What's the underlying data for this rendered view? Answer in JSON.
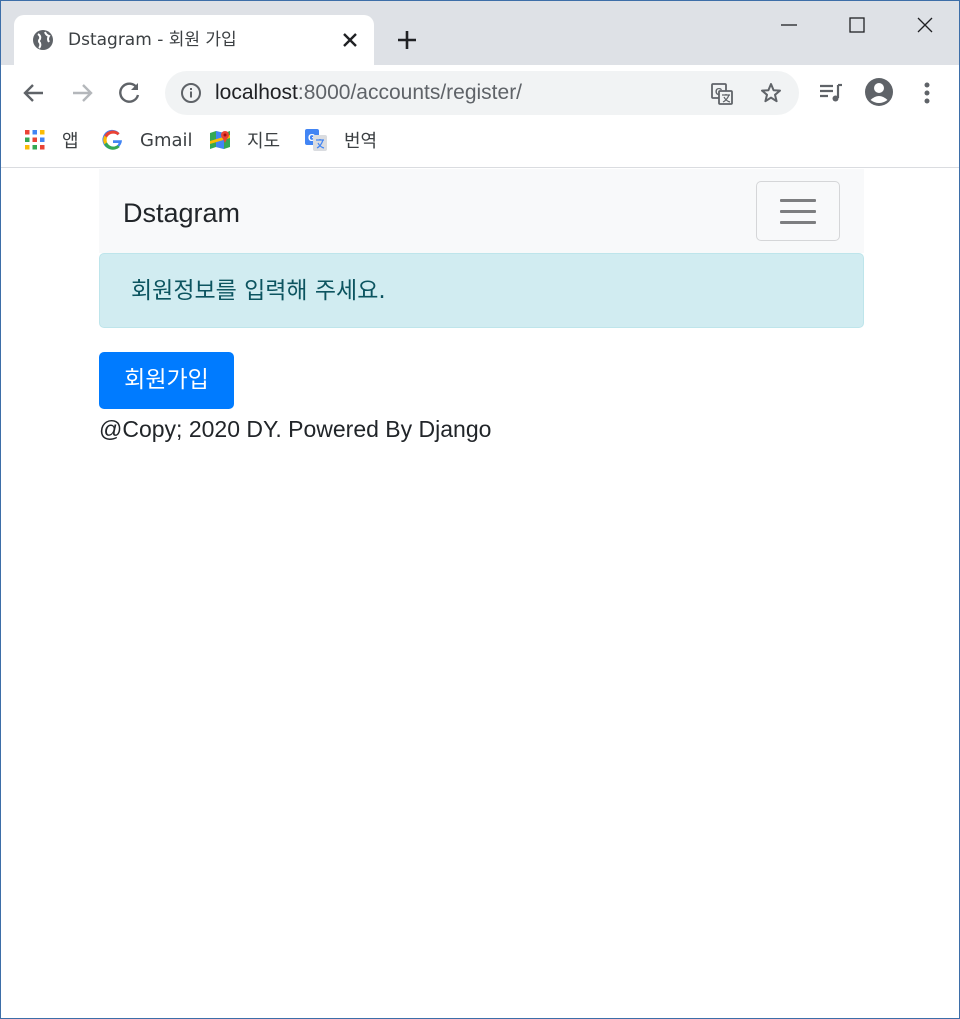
{
  "browser": {
    "tab": {
      "title": "Dstagram - 회원 가입",
      "favicon": "globe-icon"
    },
    "address": {
      "host": "localhost",
      "path": ":8000/accounts/register/"
    },
    "bookmarks": [
      {
        "label": "앱",
        "icon": "apps-grid-icon"
      },
      {
        "label": "Gmail",
        "icon": "google-icon"
      },
      {
        "label": "지도",
        "icon": "maps-icon"
      },
      {
        "label": "번역",
        "icon": "translate-icon"
      }
    ]
  },
  "page": {
    "brand": "Dstagram",
    "alert": "회원정보를 입력해 주세요.",
    "register_button": "회원가입",
    "footer": "@Copy; 2020 DY. Powered By Django"
  },
  "colors": {
    "primary": "#007bff",
    "alert_bg": "#d1ecf1",
    "alert_text": "#0c5460",
    "navbar_bg": "#f8f9fa"
  }
}
